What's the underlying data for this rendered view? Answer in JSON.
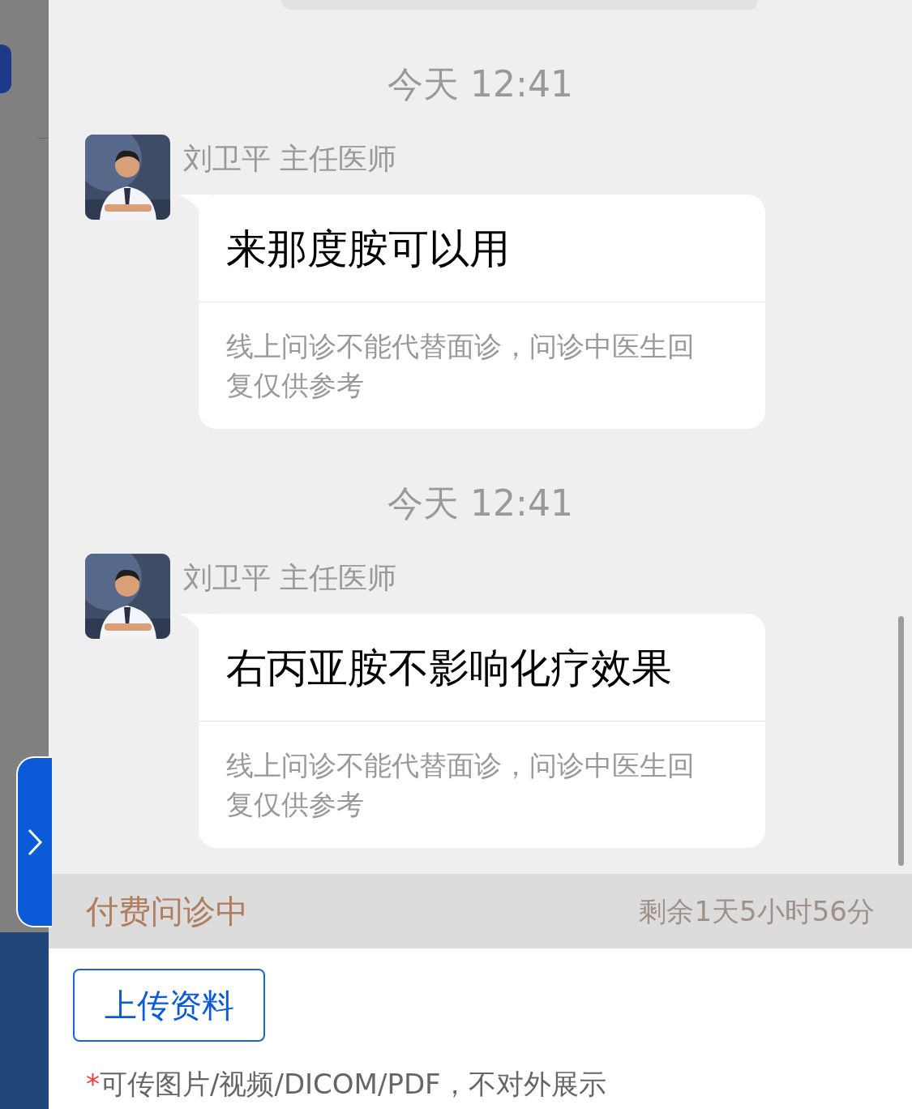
{
  "messages": [
    {
      "time": "今天 12:41",
      "sender": "刘卫平 主任医师",
      "text": "来那度胺可以用",
      "disclaimer": "线上问诊不能代替面诊，问诊中医生回复仅供参考"
    },
    {
      "time": "今天 12:41",
      "sender": "刘卫平 主任医师",
      "text": "右丙亚胺不影响化疗效果",
      "disclaimer": "线上问诊不能代替面诊，问诊中医生回复仅供参考"
    }
  ],
  "status_bar": {
    "state": "付费问诊中",
    "remaining": "剩余1天5小时56分"
  },
  "upload_button": "上传资料",
  "note": {
    "mark": "*",
    "text": "可传图片/视频/DICOM/PDF，不对外展示"
  }
}
